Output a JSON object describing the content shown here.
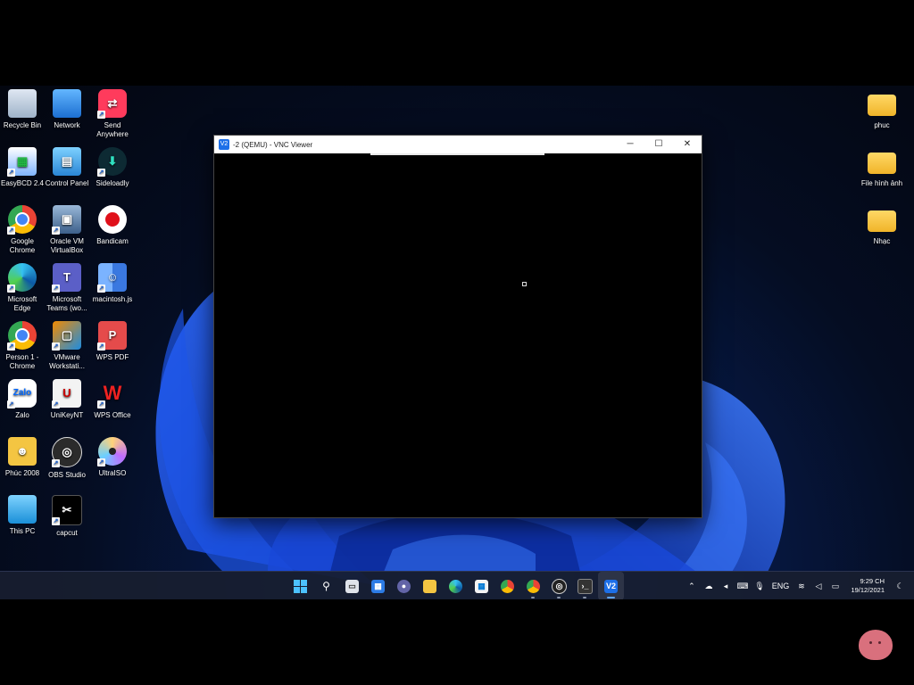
{
  "desktop_icons": [
    {
      "label": "Recycle Bin"
    },
    {
      "label": "Network"
    },
    {
      "label": "Send Anywhere"
    },
    {
      "label": "EasyBCD 2.4"
    },
    {
      "label": "Control Panel"
    },
    {
      "label": "Sideloadly"
    },
    {
      "label": "Google Chrome"
    },
    {
      "label": "Oracle VM VirtualBox"
    },
    {
      "label": "Bandicam"
    },
    {
      "label": "Microsoft Edge"
    },
    {
      "label": "Microsoft Teams (wo..."
    },
    {
      "label": "macintosh.js"
    },
    {
      "label": "Person 1 - Chrome"
    },
    {
      "label": "VMware Workstati..."
    },
    {
      "label": "WPS PDF"
    },
    {
      "label": "Zalo"
    },
    {
      "label": "UniKeyNT"
    },
    {
      "label": "WPS Office"
    },
    {
      "label": "Phúc 2008"
    },
    {
      "label": "OBS Studio"
    },
    {
      "label": "UltraISO"
    },
    {
      "label": "This PC"
    },
    {
      "label": "capcut"
    }
  ],
  "right_icons": [
    {
      "label": "phuc"
    },
    {
      "label": "File hình ảnh"
    },
    {
      "label": "Nhạc"
    }
  ],
  "vnc_window": {
    "title": "-2 (QEMU) - VNC Viewer",
    "app_icon": "V2",
    "minimize": "─",
    "maximize": "☐",
    "close": "✕"
  },
  "taskbar": {
    "apps": [
      "windows-start-icon",
      "search-icon",
      "task-view-icon",
      "widgets-icon",
      "teams-chat-icon",
      "file-explorer-icon",
      "edge-icon",
      "store-icon",
      "chrome-icon",
      "chrome-profile-icon",
      "obs-icon",
      "terminal-icon",
      "vnc-viewer-icon"
    ],
    "language": "ENG",
    "time": "9:29 CH",
    "date": "19/12/2021"
  },
  "colors": {
    "accent": "#1d6fe8",
    "taskbar": "#181e30",
    "folder": "#f4c542"
  }
}
